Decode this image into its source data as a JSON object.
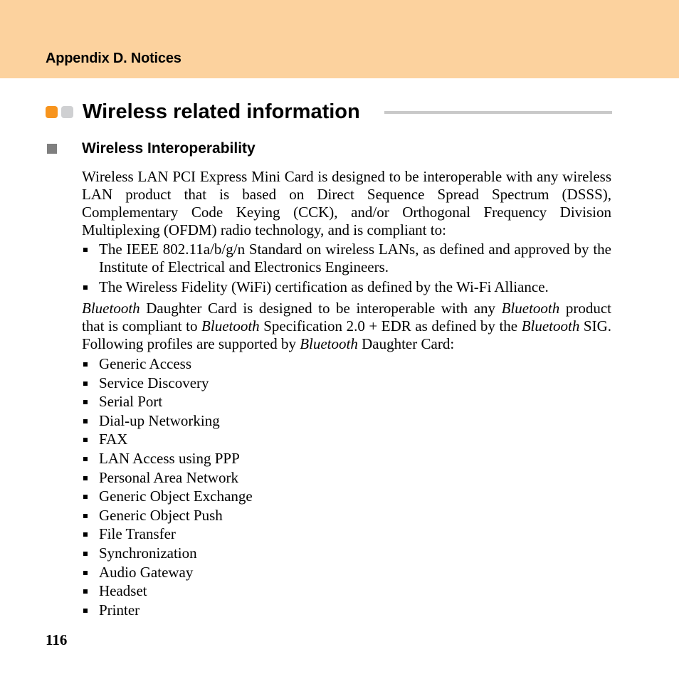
{
  "header": {
    "title": "Appendix D. Notices",
    "band_color": "#fcd29e"
  },
  "section": {
    "title": "Wireless related information",
    "dot_colors": [
      "#f7941d",
      "#cfd0d2"
    ]
  },
  "subsection": {
    "title": "Wireless Interoperability"
  },
  "paragraph1": "Wireless LAN PCI Express Mini Card is designed to be interoperable with any wireless LAN product that is based on Direct Sequence Spread Spectrum (DSSS), Complementary Code Keying (CCK), and/or Orthogonal Frequency Division Multiplexing (OFDM) radio technology, and is compliant to:",
  "compliance_list": [
    "The IEEE 802.11a/b/g/n Standard on wireless LANs, as defined and approved by the Institute of Electrical and Electronics Engineers.",
    "The Wireless Fidelity (WiFi) certification as defined by the Wi-Fi Alliance."
  ],
  "paragraph2": {
    "bt": "Bluetooth",
    "s1": " Daughter Card is designed to be interoperable with any ",
    "s2": " product that is compliant to ",
    "s3": " Specification 2.0 + EDR as defined by the ",
    "s4": " SIG. Following profiles are supported by ",
    "s5": " Daughter Card:"
  },
  "profiles": [
    "Generic Access",
    "Service Discovery",
    "Serial Port",
    "Dial-up Networking",
    "FAX",
    "LAN Access using PPP",
    "Personal Area Network",
    "Generic Object Exchange",
    "Generic Object Push",
    "File Transfer",
    "Synchronization",
    "Audio Gateway",
    "Headset",
    "Printer"
  ],
  "page_number": "116"
}
